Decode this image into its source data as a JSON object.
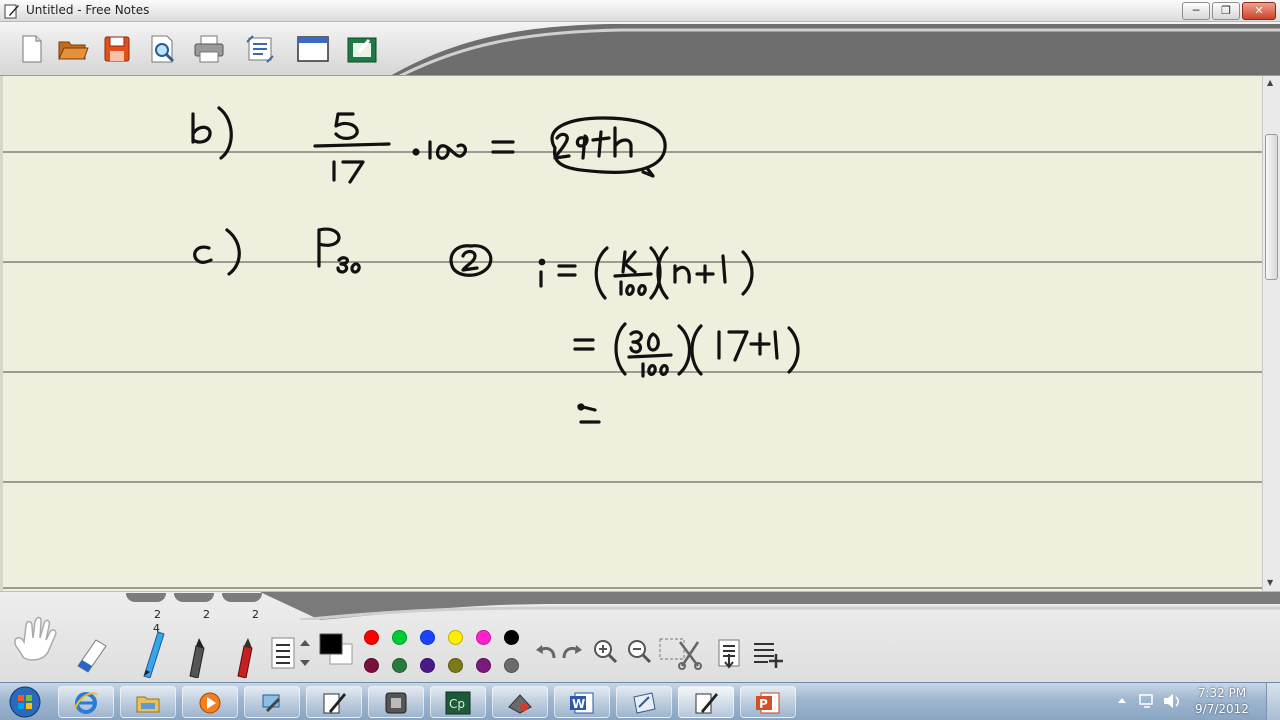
{
  "window": {
    "title": "Untitled - Free Notes",
    "minimize": "─",
    "maximize": "❐",
    "close": "✕"
  },
  "toolbar": {
    "buttons": [
      "new-page",
      "open-file",
      "save",
      "print-preview",
      "print",
      "page-settings",
      "screen-capture",
      "export-image"
    ]
  },
  "palette": {
    "pen_sizes": [
      "2",
      "2",
      "2"
    ],
    "pen_size_sub": "4",
    "colors_top": [
      "#000000",
      "#ff0000",
      "#00cc33",
      "#1a44ff",
      "#ffee00",
      "#ff22cc",
      "#000000"
    ],
    "colors_bottom": [
      "#7a1040",
      "#2a7a3a",
      "#4a1a8a",
      "#7a7a1a",
      "#7a1a7a",
      "#6a6a6a"
    ]
  },
  "taskbar": {
    "apps": [
      "internet-explorer",
      "file-explorer",
      "media-player",
      "network-tool",
      "free-notes",
      "media-center",
      "captivate",
      "draw-app",
      "word",
      "presentation-board",
      "free-notes-active",
      "powerpoint"
    ],
    "captivate_label": "Cp",
    "word_label": "W",
    "time": "7:32 PM",
    "date": "9/7/2012"
  },
  "notes": {
    "part_b_label": "b)",
    "part_c_label": "c)",
    "circled_answer": "29th",
    "step_marker": "2"
  }
}
